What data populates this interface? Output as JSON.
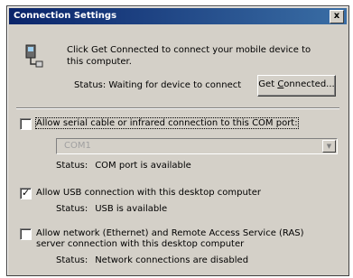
{
  "window": {
    "title": "Connection Settings",
    "close_label": "x"
  },
  "intro": {
    "text": "Click Get Connected to connect your mobile device to this computer.",
    "status_label": "Status:",
    "status_value": "Waiting for device to connect",
    "button_label_prefix": "Get ",
    "button_label_underlined": "C",
    "button_label_suffix": "onnected..."
  },
  "serial": {
    "checked": false,
    "label": "Allow serial cable or infrared connection to this COM port:",
    "port_value": "COM1",
    "status_label": "Status:",
    "status_value": "COM port is available"
  },
  "usb": {
    "checked": true,
    "label": "Allow USB connection with this desktop computer",
    "status_label": "Status:",
    "status_value": "USB is available"
  },
  "network": {
    "checked": false,
    "label": "Allow network (Ethernet) and Remote Access Service (RAS) server connection with this desktop computer",
    "status_label": "Status:",
    "status_value": "Network connections are disabled"
  },
  "icons": {
    "device": "mobile-device-icon",
    "combo_arrow": "chevron-down-icon"
  },
  "colors": {
    "face": "#d4d0c8",
    "title_from": "#0a246a",
    "title_to": "#3a6ea5"
  }
}
